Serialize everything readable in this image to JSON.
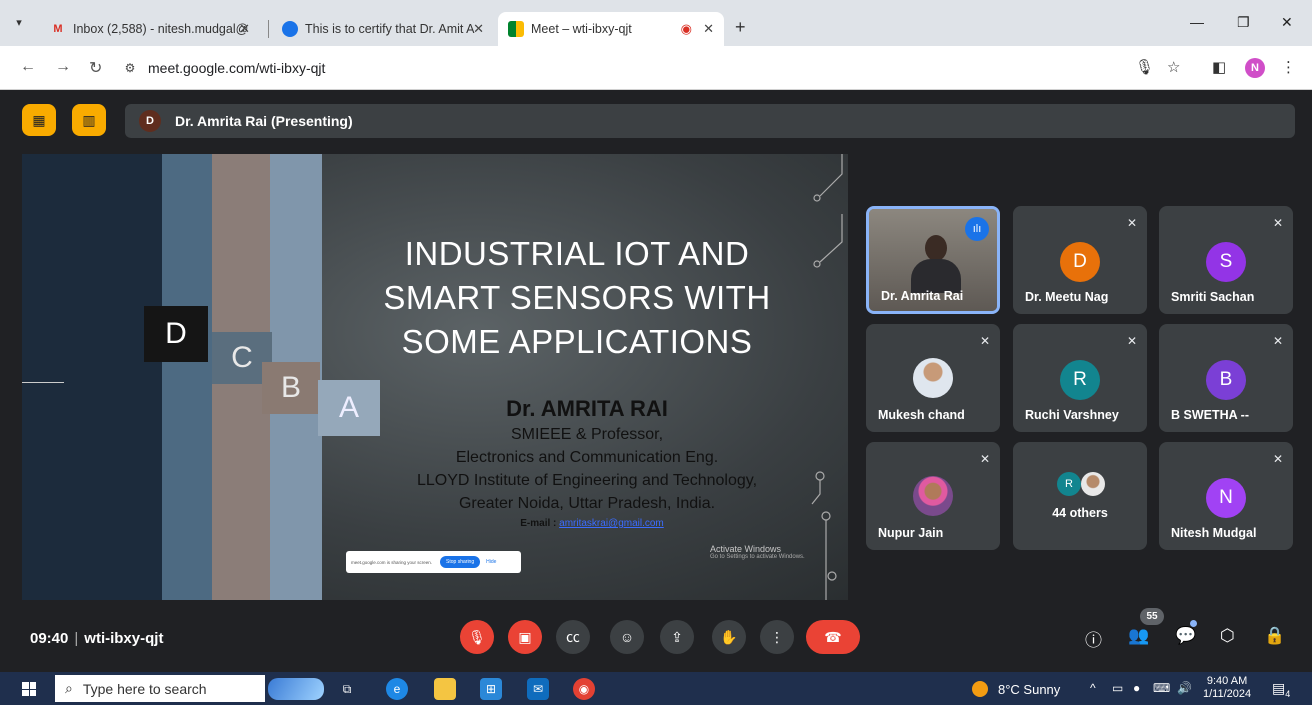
{
  "browser": {
    "tabs": [
      {
        "label": "Inbox (2,588) - nitesh.mudgal@",
        "icon": "gmail-icon"
      },
      {
        "label": "This is to certify that Dr. Amit A",
        "icon": "forms-icon"
      },
      {
        "label": "Meet – wti-ibxy-qjt",
        "icon": "meet-icon"
      }
    ],
    "url": "meet.google.com/wti-ibxy-qjt",
    "profile_initial": "N"
  },
  "meet": {
    "presenter_initial": "D",
    "presenter_label": "Dr. Amrita Rai (Presenting)",
    "slide": {
      "title_lines": [
        "INDUSTRIAL IOT  AND",
        "SMART SENSORS  WITH",
        "SOME APPLICATIONS"
      ],
      "author": "Dr. AMRITA RAI",
      "role": "SMIEEE & Professor,",
      "dept": "Electronics and Communication Eng.",
      "institute": "LLOYD Institute of Engineering and  Technology,",
      "location": "Greater Noida, Uttar Pradesh, India.",
      "email_label": "E-mail :",
      "email": "amritaskrai@gmail.com",
      "blocks": [
        "D",
        "C",
        "B",
        "A"
      ],
      "share_text": "meet.google.com is sharing your screen.",
      "stop_sharing": "Stop sharing",
      "hide": "Hide",
      "activate_title": "Activate Windows",
      "activate_sub": "Go to Settings to activate Windows."
    },
    "participants": [
      {
        "name": "Dr. Amrita Rai",
        "initial": "",
        "color": "",
        "muted": false
      },
      {
        "name": "Dr. Meetu Nag",
        "initial": "D",
        "color": "#e8710a",
        "muted": true
      },
      {
        "name": "Smriti Sachan",
        "initial": "S",
        "color": "#9334e6",
        "muted": true
      },
      {
        "name": "Mukesh chand",
        "initial": "",
        "color": "",
        "muted": true
      },
      {
        "name": "Ruchi Varshney",
        "initial": "R",
        "color": "#12858f",
        "muted": true
      },
      {
        "name": "B SWETHA --",
        "initial": "B",
        "color": "#7b3fd6",
        "muted": true
      },
      {
        "name": "Nupur Jain",
        "initial": "",
        "color": "",
        "muted": true
      },
      {
        "name": "44 others",
        "initial": "R",
        "color": "#12858f",
        "muted": false
      },
      {
        "name": "Nitesh Mudgal",
        "initial": "N",
        "color": "#a142f4",
        "muted": true
      }
    ],
    "time": "09:40",
    "meeting_code": "wti-ibxy-qjt",
    "participant_count": "55"
  },
  "taskbar": {
    "search_placeholder": "Type here to search",
    "weather": "8°C  Sunny",
    "time": "9:40 AM",
    "date": "1/11/2024",
    "notification_count": "4"
  }
}
